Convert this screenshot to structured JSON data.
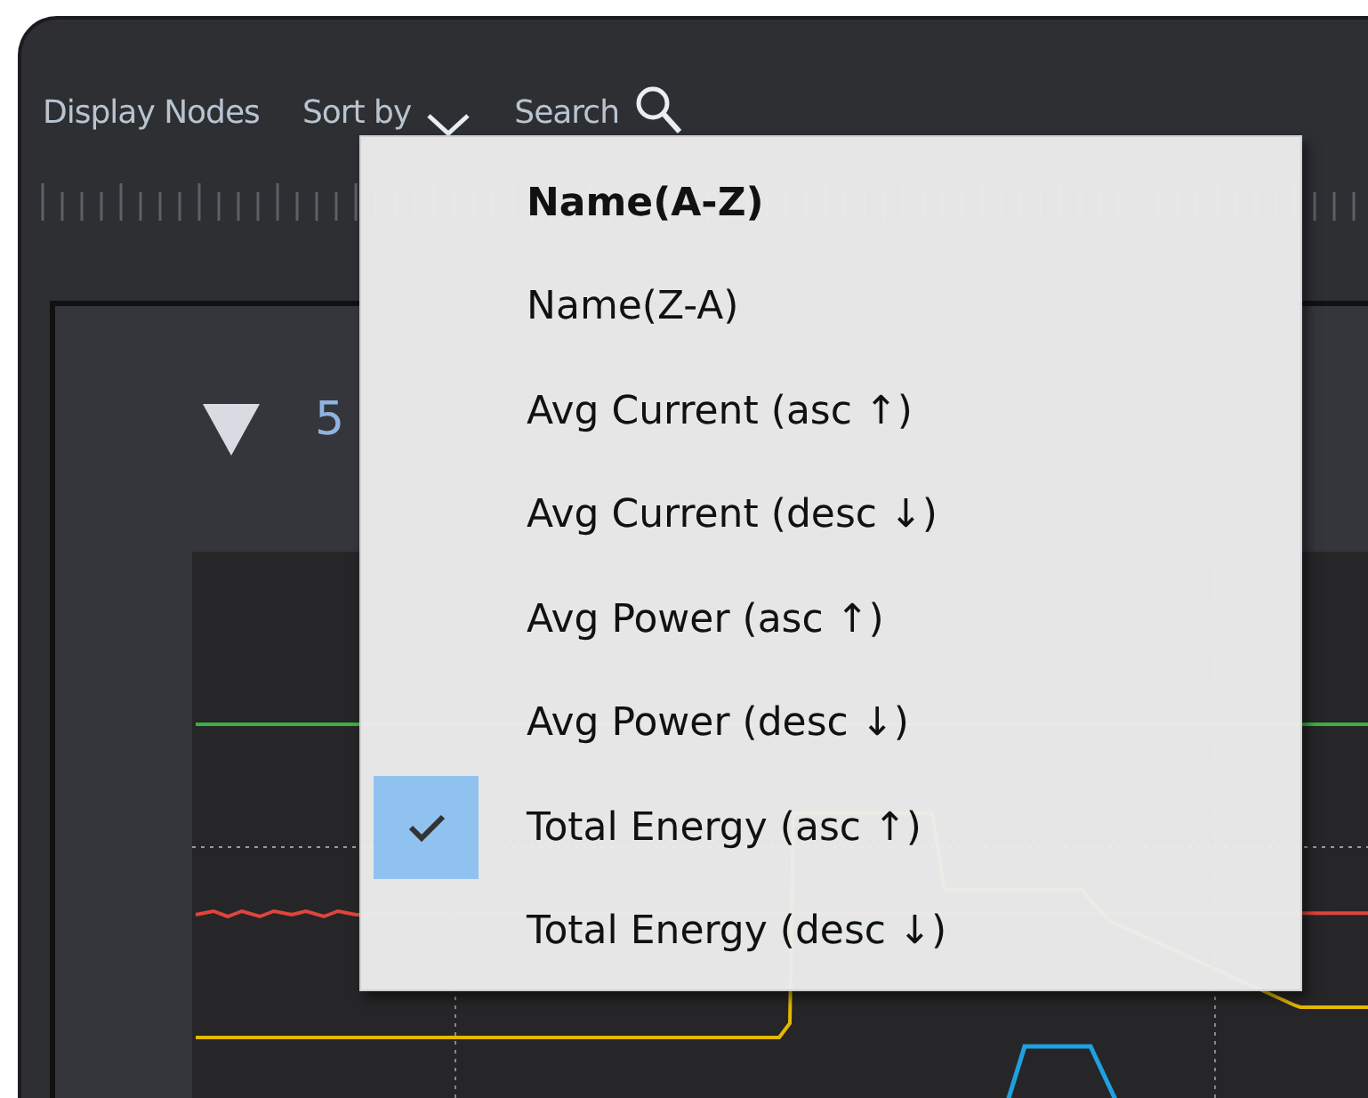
{
  "toolbar": {
    "display_nodes": "Display Nodes",
    "sort_by": "Sort by",
    "search": "Search"
  },
  "group": {
    "expanded": true,
    "label": "5"
  },
  "sort_menu": {
    "items": [
      {
        "label": "Name(A-Z)",
        "default": true,
        "checked": false
      },
      {
        "label": "Name(Z-A)",
        "default": false,
        "checked": false
      },
      {
        "label": "Avg Current (asc ↑)",
        "default": false,
        "checked": false
      },
      {
        "label": "Avg Current (desc ↓)",
        "default": false,
        "checked": false
      },
      {
        "label": "Avg Power (asc ↑)",
        "default": false,
        "checked": false
      },
      {
        "label": "Avg Power (desc ↓)",
        "default": false,
        "checked": false
      },
      {
        "label": "Total Energy (asc ↑)",
        "default": false,
        "checked": true
      },
      {
        "label": "Total Energy (desc ↓)",
        "default": false,
        "checked": false
      }
    ]
  }
}
